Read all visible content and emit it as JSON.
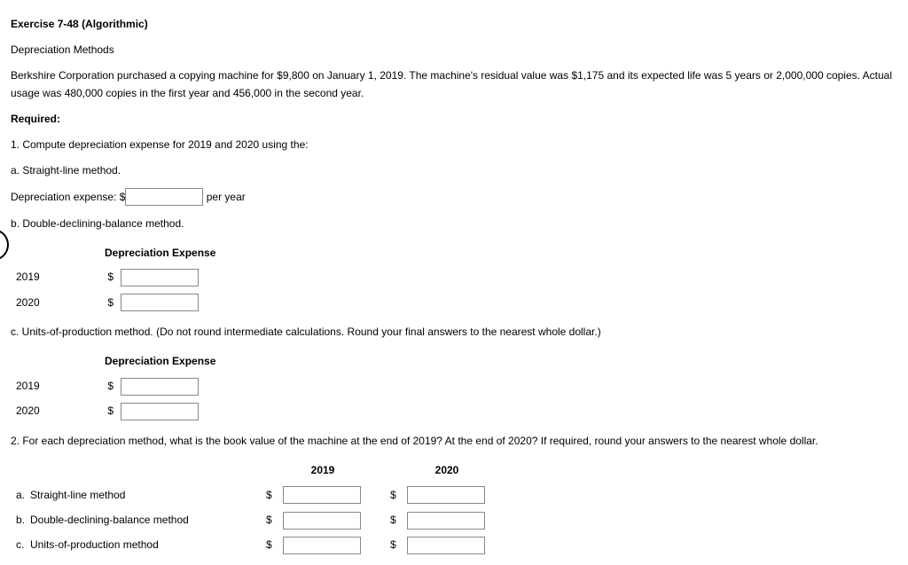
{
  "title": "Exercise 7-48 (Algorithmic)",
  "subtitle": "Depreciation Methods",
  "description": "Berkshire Corporation purchased a copying machine for $9,800 on January 1, 2019. The machine's residual value was $1,175 and its expected life was 5 years or 2,000,000 copies. Actual usage was 480,000 copies in the first year and 456,000 in the second year.",
  "required_label": "Required:",
  "q1": {
    "prompt": "1.  Compute depreciation expense for 2019 and 2020 using the:",
    "a": {
      "label": "a.  Straight-line method.",
      "line_prefix": "Depreciation expense: $",
      "line_suffix": " per year"
    },
    "b": {
      "label": "b.  Double-declining-balance method.",
      "table_header": "Depreciation Expense",
      "year1": "2019",
      "year2": "2020",
      "dollar": "$"
    },
    "c": {
      "label": "c.  Units-of-production method. (Do not round intermediate calculations. Round your final answers to the nearest whole dollar.)",
      "table_header": "Depreciation Expense",
      "year1": "2019",
      "year2": "2020",
      "dollar": "$"
    }
  },
  "q2": {
    "prompt": "2.  For each depreciation method, what is the book value of the machine at the end of 2019? At the end of 2020? If required, round your answers to the nearest whole dollar.",
    "col1": "2019",
    "col2": "2020",
    "rows": [
      {
        "letter": "a.",
        "label": "Straight-line method"
      },
      {
        "letter": "b.",
        "label": "Double-declining-balance method"
      },
      {
        "letter": "c.",
        "label": "Units-of-production method"
      }
    ],
    "dollar": "$"
  }
}
